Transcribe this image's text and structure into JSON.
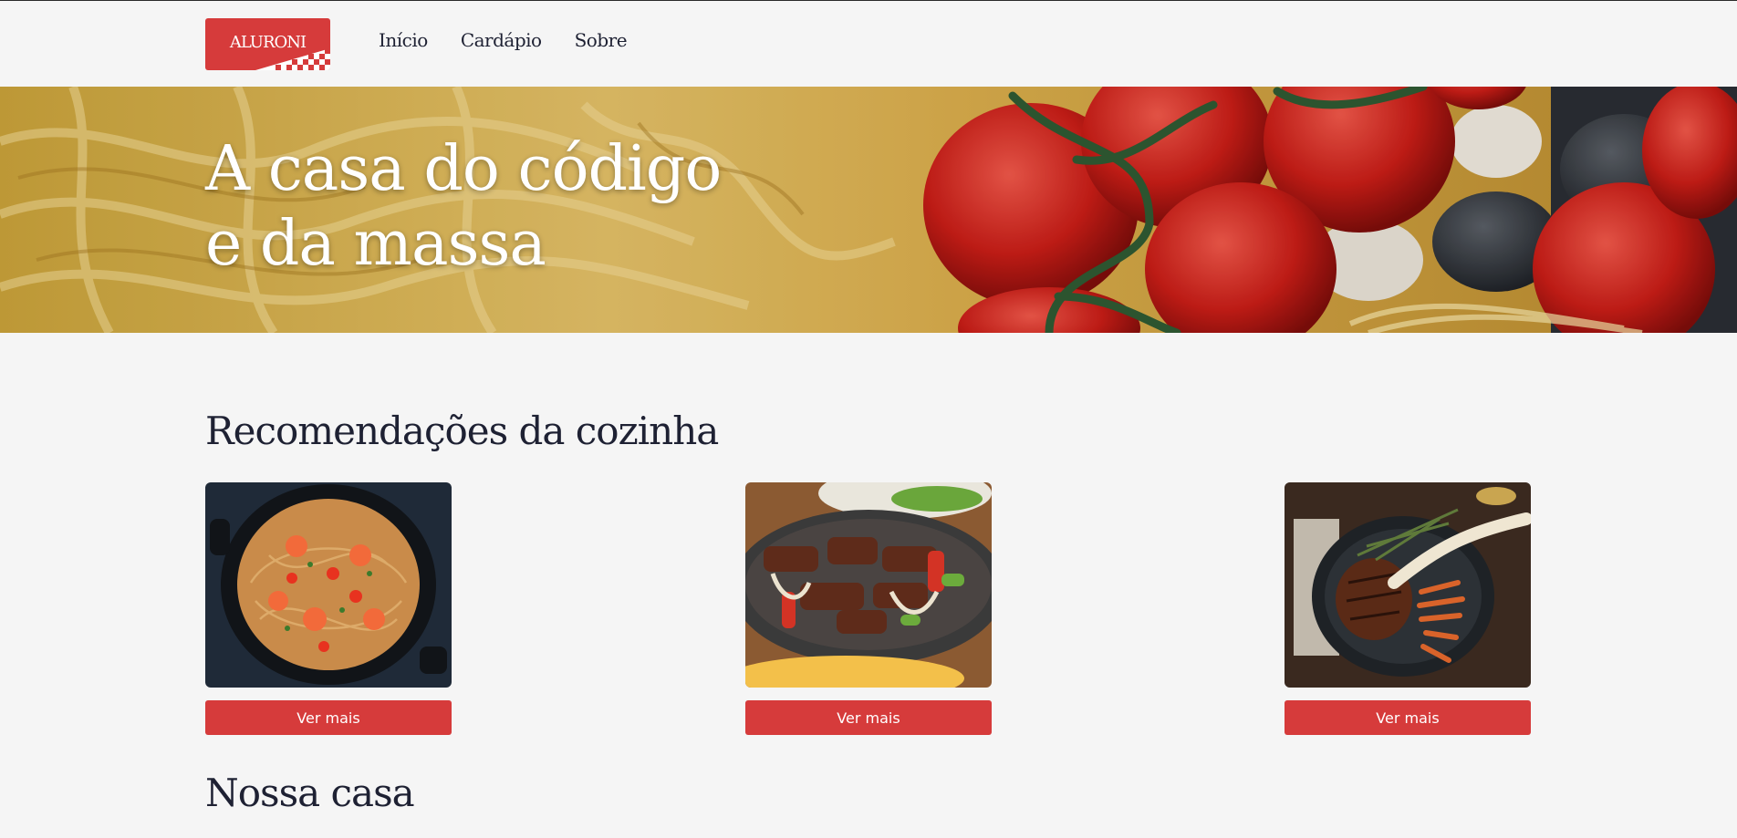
{
  "brand": {
    "logo_text": "ALURONI",
    "accent_color": "#d63b3b"
  },
  "nav": {
    "items": [
      {
        "label": "Início"
      },
      {
        "label": "Cardápio"
      },
      {
        "label": "Sobre"
      }
    ]
  },
  "hero": {
    "title_line1": "A casa do código",
    "title_line2": "e da massa"
  },
  "recommendations": {
    "title": "Recomendações da cozinha",
    "cards": [
      {
        "image": "shrimp-spaghetti-pan",
        "button_label": "Ver mais"
      },
      {
        "image": "beef-fajitas-skillet",
        "button_label": "Ver mais"
      },
      {
        "image": "tomahawk-steak-pan",
        "button_label": "Ver mais"
      }
    ]
  },
  "house": {
    "title": "Nossa casa"
  }
}
